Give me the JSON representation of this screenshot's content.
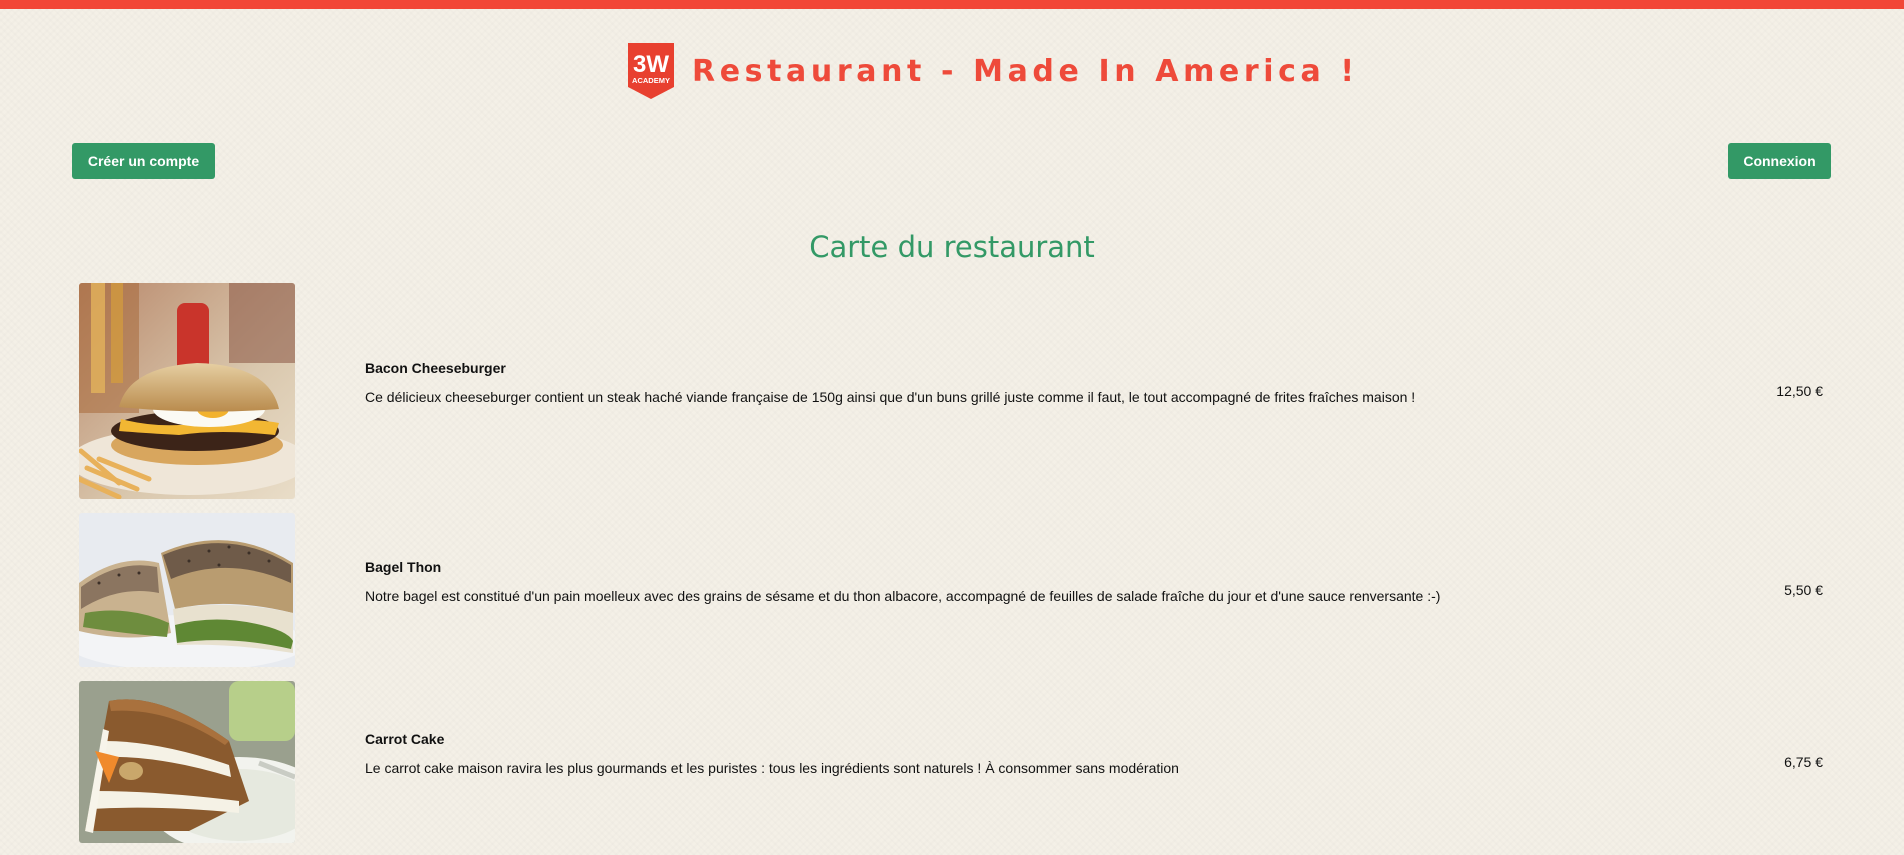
{
  "header": {
    "title": "Restaurant - Made In America !",
    "logo_text_top": "3W",
    "logo_text_bottom": "ACADEMY",
    "accent_color": "#f24637"
  },
  "auth": {
    "signup_label": "Créer un compte",
    "login_label": "Connexion",
    "button_color": "#339966"
  },
  "menu": {
    "title": "Carte du restaurant",
    "items": [
      {
        "name": "Bacon Cheeseburger",
        "description": "Ce délicieux cheeseburger contient un steak haché viande française de 150g ainsi que d'un buns grillé juste comme il faut, le tout accompagné de frites fraîches maison !",
        "price": "12,50 €",
        "image": "burger-photo"
      },
      {
        "name": "Bagel Thon",
        "description": "Notre bagel est constitué d'un pain moelleux avec des grains de sésame et du thon albacore, accompagné de feuilles de salade fraîche du jour et d'une sauce renversante :-)",
        "price": "5,50 €",
        "image": "bagel-photo"
      },
      {
        "name": "Carrot Cake",
        "description": "Le carrot cake maison ravira les plus gourmands et les puristes : tous les ingrédients sont naturels ! À consommer sans modération",
        "price": "6,75 €",
        "image": "carrot-cake-photo"
      }
    ]
  }
}
